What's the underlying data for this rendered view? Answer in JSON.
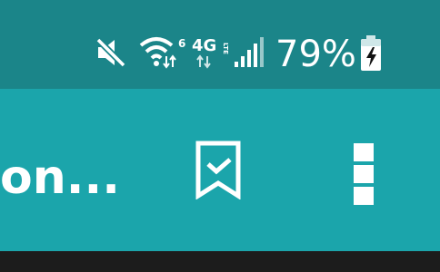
{
  "status_bar": {
    "icons": [
      "mute-icon",
      "wifi-icon",
      "lte-icon",
      "signal-icon",
      "battery-charging-icon"
    ],
    "wifi_badge": "6",
    "network_label": "4G",
    "network_sub": "LTE",
    "battery_percent": "79%"
  },
  "app_bar": {
    "title": "on...",
    "actions": [
      "bookmark-check-icon",
      "more-vert-icon"
    ]
  },
  "colors": {
    "status_bar": "#1b8589",
    "app_bar": "#1ba5ab",
    "bottom": "#1c1c1c",
    "foreground": "#ffffff"
  }
}
